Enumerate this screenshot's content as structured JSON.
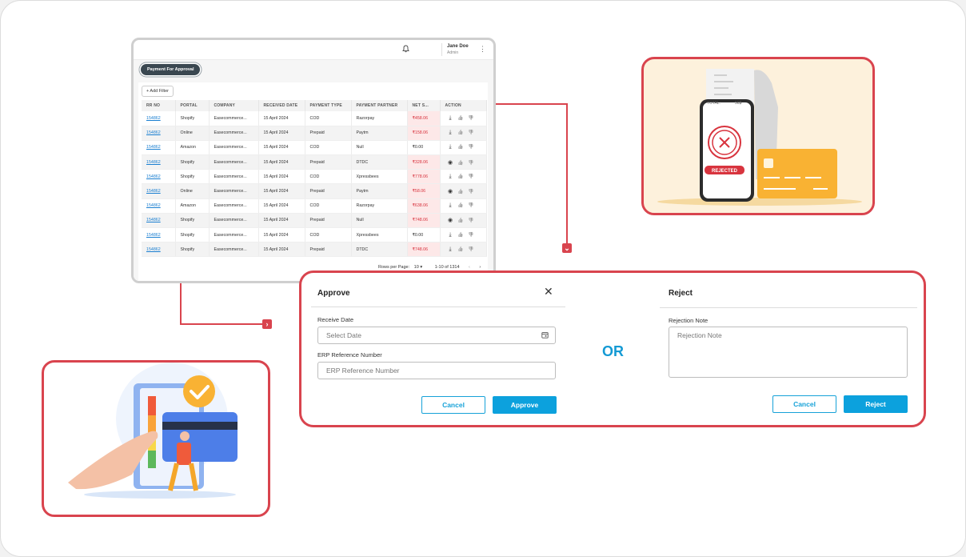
{
  "table_card": {
    "user_name": "Jane Doe",
    "user_role": "Admin",
    "tab_label": "Payment For Approval",
    "add_filter": "+ Add Filter",
    "columns": [
      "RR NO",
      "PORTAL",
      "COMPANY",
      "RECEIVED DATE",
      "PAYMENT TYPE",
      "PAYMENT PARTNER",
      "NET S...",
      "ACTION"
    ],
    "rows": [
      {
        "rr": "154862",
        "portal": "Shopify",
        "company": "Easecommerce...",
        "date": "15 April 2024",
        "type": "COD",
        "partner": "Razorpay",
        "net": "₹458.06",
        "net_red": true,
        "first_action": "download-icon"
      },
      {
        "rr": "154862",
        "portal": "Online",
        "company": "Easecommerce...",
        "date": "15 April 2024",
        "type": "Prepaid",
        "partner": "Paytm",
        "net": "₹158.06",
        "net_red": true,
        "first_action": "download-icon"
      },
      {
        "rr": "154862",
        "portal": "Amazon",
        "company": "Easecommerce...",
        "date": "15 April 2024",
        "type": "COD",
        "partner": "Null",
        "net": "₹0.00",
        "net_red": false,
        "first_action": "download-icon"
      },
      {
        "rr": "154862",
        "portal": "Shopify",
        "company": "Easecommerce...",
        "date": "15 April 2024",
        "type": "Prepaid",
        "partner": "DTDC",
        "net": "₹328.06",
        "net_red": true,
        "first_action": "user-circle-icon"
      },
      {
        "rr": "154862",
        "portal": "Shopify",
        "company": "Easecommerce...",
        "date": "15 April 2024",
        "type": "COD",
        "partner": "Xpressbees",
        "net": "₹778.06",
        "net_red": true,
        "first_action": "download-icon"
      },
      {
        "rr": "154862",
        "portal": "Online",
        "company": "Easecommerce...",
        "date": "15 April 2024",
        "type": "Prepaid",
        "partner": "Paytm",
        "net": "₹58.06",
        "net_red": true,
        "first_action": "user-circle-icon"
      },
      {
        "rr": "154862",
        "portal": "Amazon",
        "company": "Easecommerce...",
        "date": "15 April 2024",
        "type": "COD",
        "partner": "Razorpay",
        "net": "₹638.06",
        "net_red": true,
        "first_action": "download-icon"
      },
      {
        "rr": "154862",
        "portal": "Shopify",
        "company": "Easecommerce...",
        "date": "15 April 2024",
        "type": "Prepaid",
        "partner": "Null",
        "net": "₹748.06",
        "net_red": true,
        "first_action": "user-circle-icon"
      },
      {
        "rr": "154862",
        "portal": "Shopify",
        "company": "Easecommerce...",
        "date": "15 April 2024",
        "type": "COD",
        "partner": "Xpressbees",
        "net": "₹0.00",
        "net_red": false,
        "first_action": "download-icon"
      },
      {
        "rr": "154862",
        "portal": "Shopify",
        "company": "Easecommerce...",
        "date": "15 April 2024",
        "type": "Prepaid",
        "partner": "DTDC",
        "net": "₹748.06",
        "net_red": true,
        "first_action": "download-icon"
      }
    ],
    "pagination": {
      "rows_per_page_label": "Rows per Page:",
      "rows_per_page_value": "10 ▾",
      "range": "1-10 of 1314"
    }
  },
  "approve_panel": {
    "title": "Approve",
    "receive_date_label": "Receive Date",
    "receive_date_placeholder": "Select Date",
    "erp_label": "ERP Reference Number",
    "erp_placeholder": "ERP Reference Number",
    "cancel_label": "Cancel",
    "approve_label": "Approve"
  },
  "or_text": "OR",
  "reject_panel": {
    "title": "Reject",
    "note_label": "Rejection Note",
    "note_placeholder": "Rejection Note",
    "cancel_label": "Cancel",
    "reject_label": "Reject"
  },
  "receipt_illustration": {
    "total_label": "TOTAL:",
    "total_value": "50$",
    "status": "REJECTED"
  },
  "colors": {
    "accent_red": "#d9444e",
    "primary_blue": "#0ca1dd",
    "net_red": "#d8333e",
    "link_blue": "#1a7fd1"
  }
}
